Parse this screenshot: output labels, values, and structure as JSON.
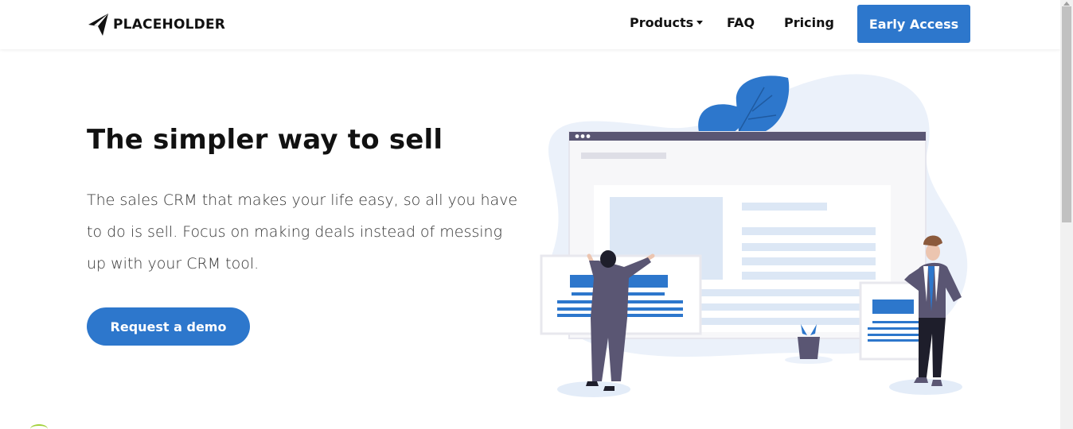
{
  "brand": {
    "name": "PLACEHOLDER"
  },
  "nav": {
    "products": "Products",
    "faq": "FAQ",
    "pricing": "Pricing",
    "early_access": "Early Access"
  },
  "hero": {
    "title": "The simpler way to sell",
    "description": "The sales CRM that makes your life easy, so all you have to do is sell. Focus on making deals instead of messing up with your CRM tool.",
    "cta": "Request a demo"
  },
  "colors": {
    "primary": "#2d77cc",
    "illustration_dark": "#5a5673",
    "illustration_light": "#dce7f5"
  },
  "icons": [
    "logo-mark-icon",
    "caret-down-icon"
  ]
}
